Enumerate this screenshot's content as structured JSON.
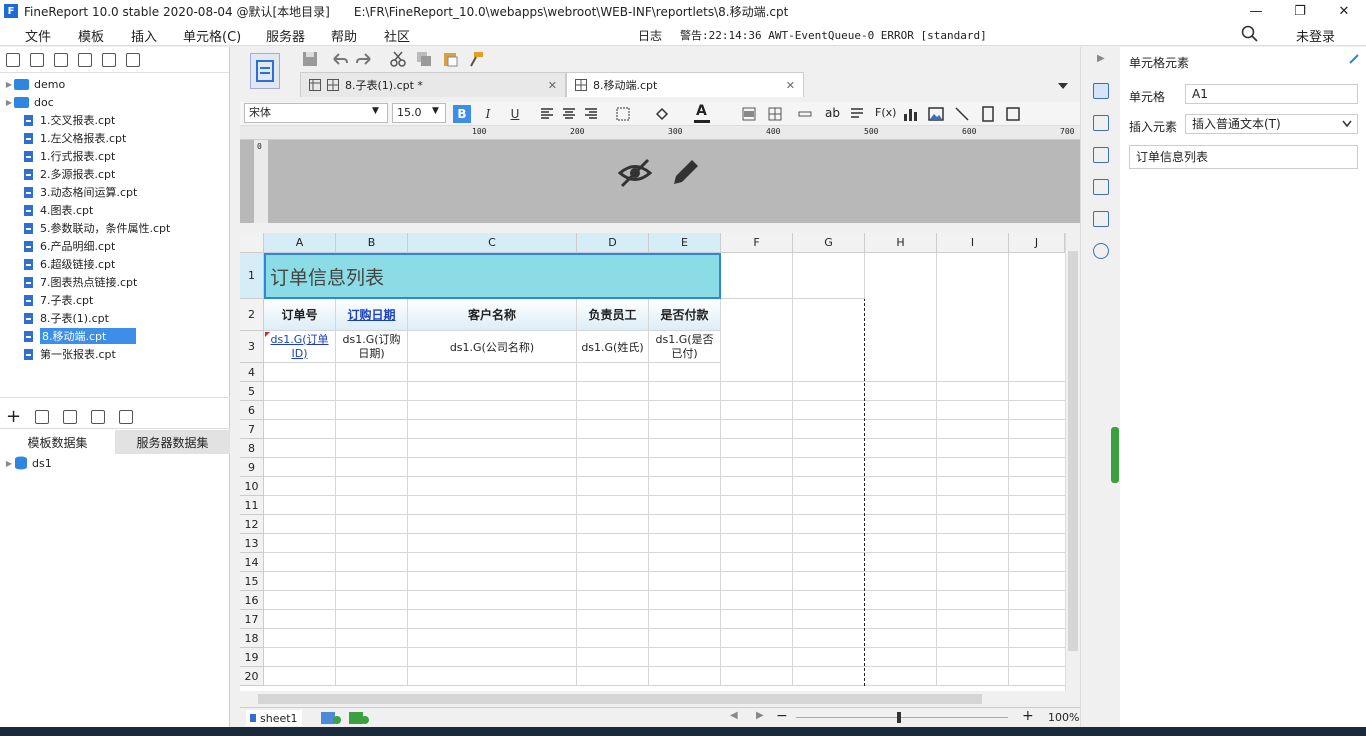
{
  "window": {
    "app_title": "FineReport 10.0 stable 2020-08-04 @默认[本地目录]",
    "file_path": "E:\\FR\\FineReport_10.0\\webapps\\webroot\\WEB-INF\\reportlets\\8.移动端.cpt",
    "minimize": "—",
    "restore": "❐",
    "close": "✕"
  },
  "menu": {
    "items": [
      "文件",
      "模板",
      "插入",
      "单元格(C)",
      "服务器",
      "帮助",
      "社区"
    ],
    "log_label": "日志",
    "warning_text": "警告:22:14:36 AWT-EventQueue-0 ERROR [standard]",
    "search_icon": "search-icon",
    "login": "未登录"
  },
  "tree": {
    "folders": [
      "demo",
      "doc"
    ],
    "files": [
      "1.交叉报表.cpt",
      "1.左父格报表.cpt",
      "1.行式报表.cpt",
      "2.多源报表.cpt",
      "3.动态格间运算.cpt",
      "4.图表.cpt",
      "5.参数联动，条件属性.cpt",
      "6.产品明细.cpt",
      "6.超级链接.cpt",
      "7.图表热点链接.cpt",
      "7.子表.cpt",
      "8.子表(1).cpt",
      "8.移动端.cpt",
      "第一张报表.cpt"
    ],
    "selected_index": 12
  },
  "datasets": {
    "tabs": [
      "模板数据集",
      "服务器数据集"
    ],
    "items": [
      "ds1"
    ]
  },
  "doc_tabs": [
    {
      "label": "8.子表(1).cpt *",
      "close": "✕"
    },
    {
      "label": "8.移动端.cpt",
      "close": "✕"
    }
  ],
  "format": {
    "font_name": "宋体",
    "font_size": "15.0",
    "bold": "B",
    "italic": "I",
    "underline": "U",
    "fx": "F(x)",
    "ab": "ab"
  },
  "ruler": {
    "ticks": [
      "100",
      "200",
      "300",
      "400",
      "500",
      "600",
      "700"
    ],
    "v_tick": "0"
  },
  "grid": {
    "columns": [
      "A",
      "B",
      "C",
      "D",
      "E",
      "F",
      "G",
      "H",
      "I",
      "J"
    ],
    "rows": [
      "1",
      "2",
      "3",
      "4",
      "5",
      "6",
      "7",
      "8",
      "9",
      "10",
      "11",
      "12",
      "13",
      "14",
      "15",
      "16",
      "17",
      "18",
      "19",
      "20"
    ],
    "title": "订单信息列表",
    "headers": [
      "订单号",
      "订购日期",
      "客户名称",
      "负责员工",
      "是否付款"
    ],
    "data_cells": [
      "ds1.G(订单ID)",
      "ds1.G(订购日期)",
      "ds1.G(公司名称)",
      "ds1.G(姓氏)",
      "ds1.G(是否已付)"
    ]
  },
  "bottom": {
    "sheet": "sheet1",
    "zoom": "100%"
  },
  "right_panel": {
    "title": "单元格元素",
    "cell_label": "单元格",
    "cell_value": "A1",
    "insert_label": "插入元素",
    "insert_value": "插入普通文本(T)",
    "content_value": "订单信息列表"
  },
  "colors": {
    "accent": "#3d8ee8",
    "title_cell": "#8cdce6",
    "header_hl": "#d6ecf7"
  }
}
